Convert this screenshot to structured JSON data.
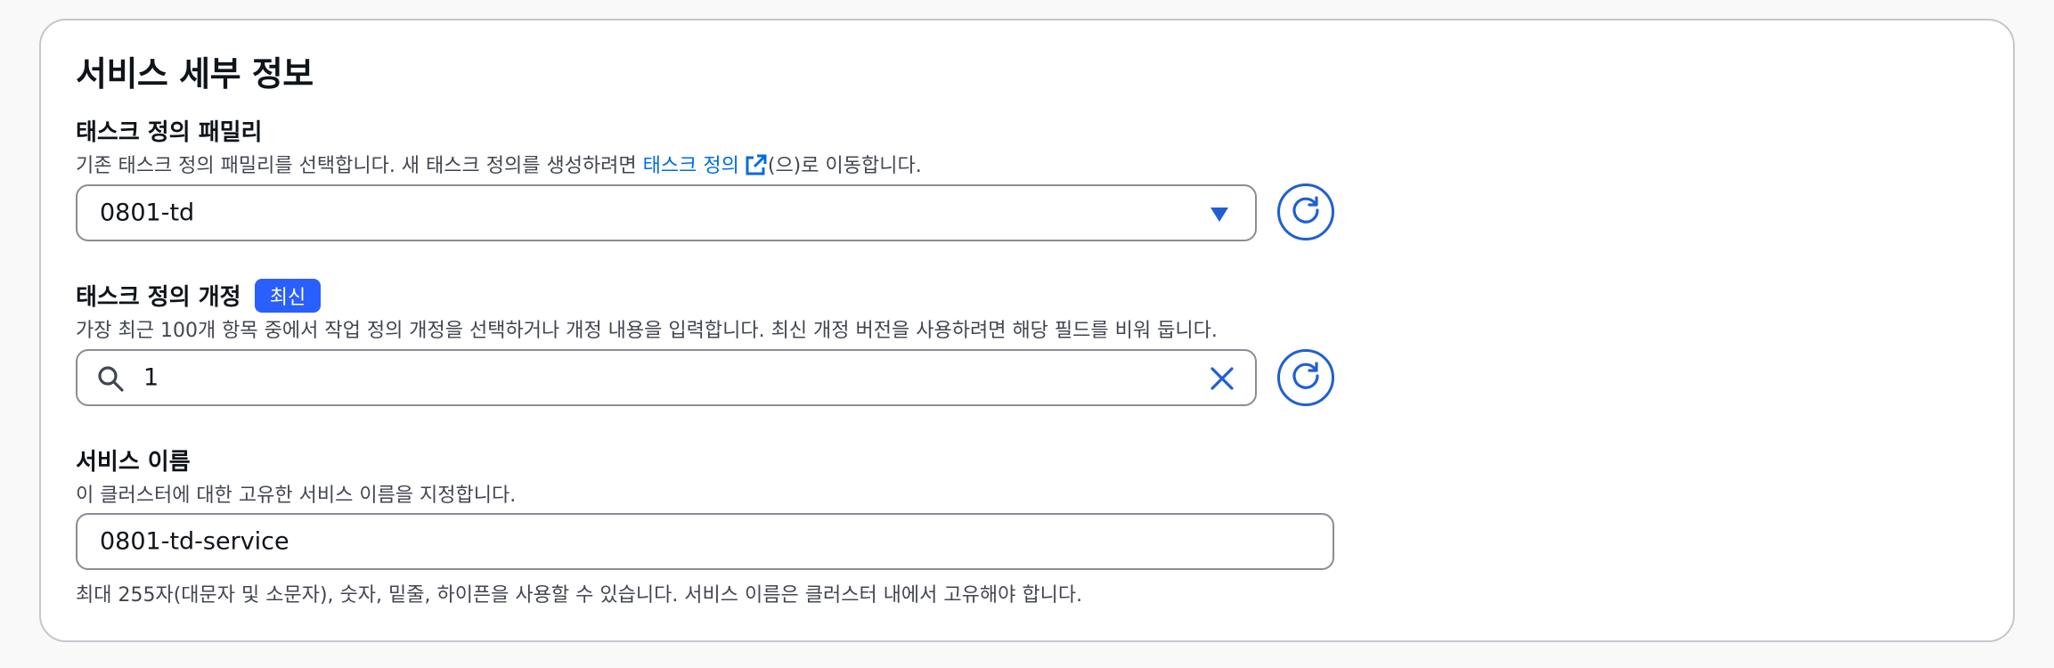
{
  "colors": {
    "accent": "#006ce0",
    "badge_bg": "#295eff",
    "icon_blue": "#1f5fd6",
    "border": "#8c8c94",
    "text": "#0f141a",
    "muted": "#424650"
  },
  "section": {
    "title": "서비스 세부 정보"
  },
  "family": {
    "label": "태스크 정의 패밀리",
    "desc_before": "기존 태스크 정의 패밀리를 선택합니다. 새 태스크 정의를 생성하려면 ",
    "link": "태스크 정의",
    "desc_after": "(으)로 이동합니다.",
    "selected": "0801-td",
    "icons": [
      "external-link-icon",
      "caret-down-icon",
      "refresh-icon"
    ]
  },
  "revision": {
    "label": "태스크 정의 개정",
    "badge": "최신",
    "desc": "가장 최근 100개 항목 중에서 작업 정의 개정을 선택하거나 개정 내용을 입력합니다. 최신 개정 버전을 사용하려면 해당 필드를 비워 둡니다.",
    "value": "1",
    "icons": [
      "search-icon",
      "clear-icon",
      "refresh-icon"
    ]
  },
  "service_name": {
    "label": "서비스 이름",
    "desc": "이 클러스터에 대한 고유한 서비스 이름을 지정합니다.",
    "value": "0801-td-service",
    "hint": "최대 255자(대문자 및 소문자), 숫자, 밑줄, 하이픈을 사용할 수 있습니다. 서비스 이름은 클러스터 내에서 고유해야 합니다."
  }
}
